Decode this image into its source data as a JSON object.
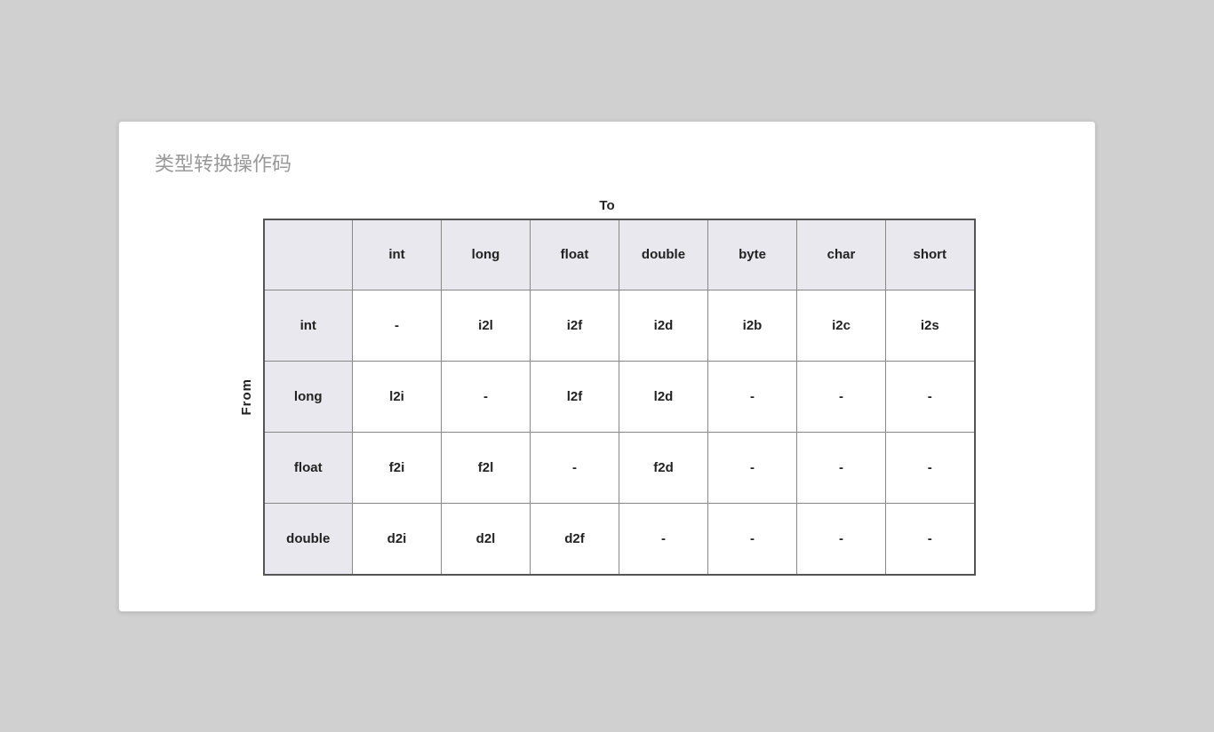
{
  "page": {
    "title": "类型转换操作码",
    "to_label": "To",
    "from_label": "From",
    "table": {
      "col_headers": [
        "",
        "int",
        "long",
        "float",
        "double",
        "byte",
        "char",
        "short"
      ],
      "rows": [
        {
          "row_header": "int",
          "cells": [
            "-",
            "i2l",
            "i2f",
            "i2d",
            "i2b",
            "i2c",
            "i2s"
          ]
        },
        {
          "row_header": "long",
          "cells": [
            "l2i",
            "-",
            "l2f",
            "l2d",
            "-",
            "-",
            "-"
          ]
        },
        {
          "row_header": "float",
          "cells": [
            "f2i",
            "f2l",
            "-",
            "f2d",
            "-",
            "-",
            "-"
          ]
        },
        {
          "row_header": "double",
          "cells": [
            "d2i",
            "d2l",
            "d2f",
            "-",
            "-",
            "-",
            "-"
          ]
        }
      ]
    }
  }
}
